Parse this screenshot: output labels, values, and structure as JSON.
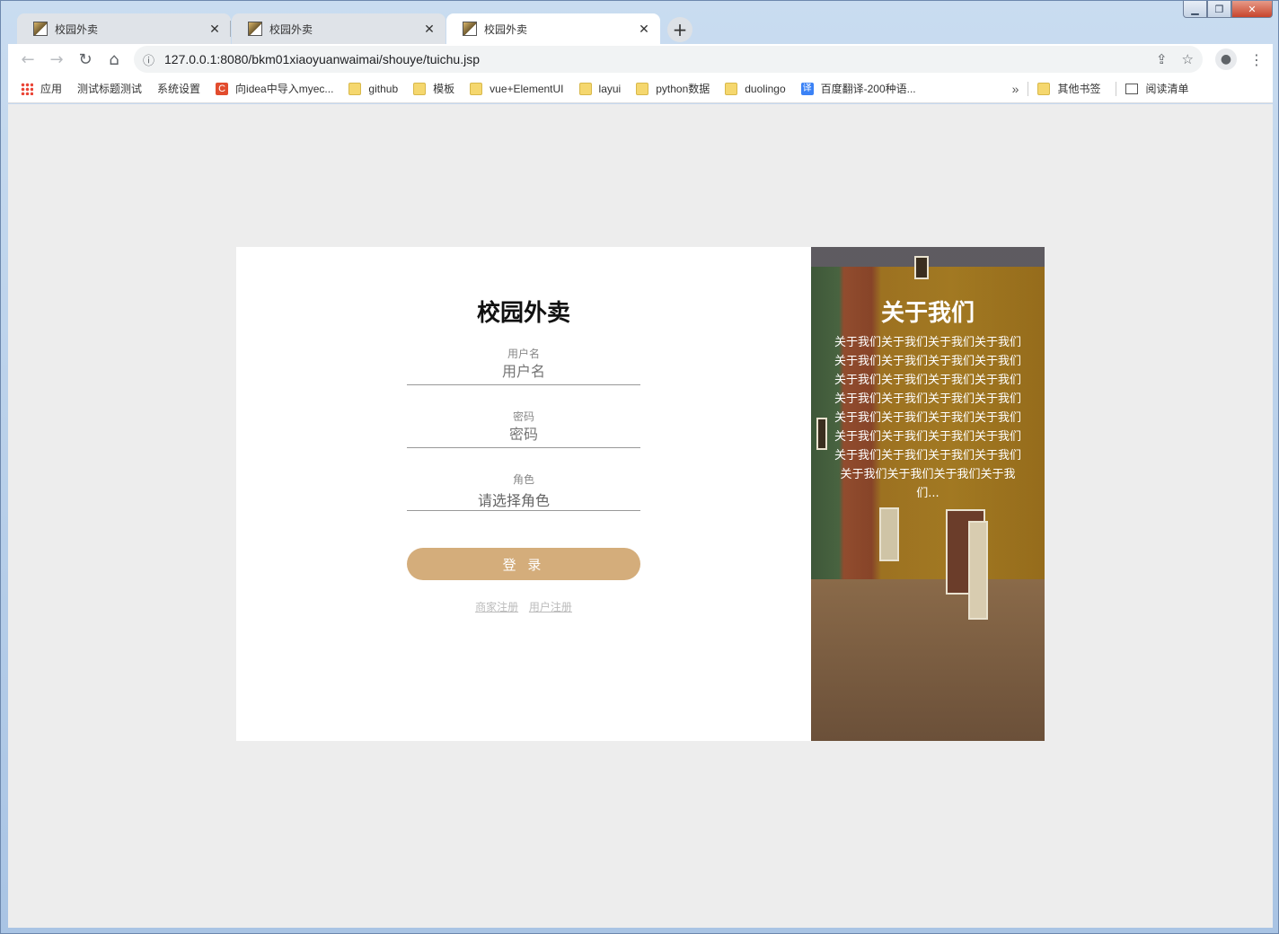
{
  "browser": {
    "tabs": [
      {
        "title": "校园外卖",
        "active": false
      },
      {
        "title": "校园外卖",
        "active": false
      },
      {
        "title": "校园外卖",
        "active": true
      }
    ],
    "url": "127.0.0.1:8080/bkm01xiaoyuanwaimai/shouye/tuichu.jsp",
    "bookmarks": [
      {
        "label": "应用",
        "icon": "apps-grid-icon"
      },
      {
        "label": "测试标题测试",
        "icon": "page-icon"
      },
      {
        "label": "系统设置",
        "icon": "page-icon"
      },
      {
        "label": "向idea中导入myec...",
        "icon": "csdn-icon"
      },
      {
        "label": "github",
        "icon": "folder-icon"
      },
      {
        "label": "模板",
        "icon": "folder-icon"
      },
      {
        "label": "vue+ElementUI",
        "icon": "folder-icon"
      },
      {
        "label": "layui",
        "icon": "folder-icon"
      },
      {
        "label": "python数据",
        "icon": "folder-icon"
      },
      {
        "label": "duolingo",
        "icon": "folder-icon"
      },
      {
        "label": "百度翻译-200种语...",
        "icon": "translate-icon"
      }
    ],
    "bookmarks_more": "»",
    "other_bookmarks": "其他书签",
    "reading_list": "阅读清单"
  },
  "login": {
    "title": "校园外卖",
    "username_label": "用户名",
    "username_placeholder": "用户名",
    "password_label": "密码",
    "password_placeholder": "密码",
    "role_label": "角色",
    "role_placeholder": "请选择角色",
    "login_button": "登 录",
    "merchant_register": "商家注册",
    "user_register": "用户注册"
  },
  "about": {
    "title": "关于我们",
    "text": "关于我们关于我们关于我们关于我们关于我们关于我们关于我们关于我们关于我们关于我们关于我们关于我们关于我们关于我们关于我们关于我们关于我们关于我们关于我们关于我们关于我们关于我们关于我们关于我们关于我们关于我们关于我们关于我们关于我们关于我们关于我们关于我们..."
  },
  "colors": {
    "accent": "#d4ad7b",
    "page_bg": "#ededed"
  }
}
